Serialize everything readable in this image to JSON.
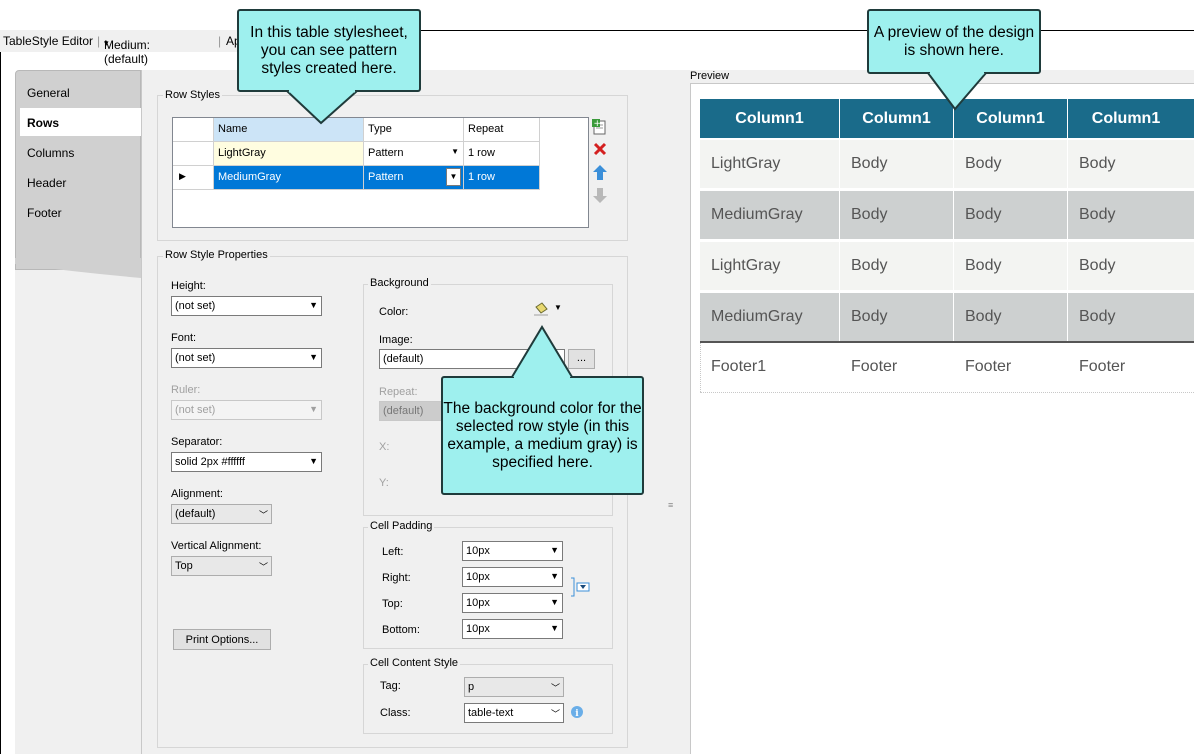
{
  "toolbar": {
    "title": "TableStyle Editor",
    "style_dropdown": "Medium: (default)",
    "truncated_button": "Ap"
  },
  "tabs": [
    {
      "label": "General",
      "active": false
    },
    {
      "label": "Rows",
      "active": true
    },
    {
      "label": "Columns",
      "active": false
    },
    {
      "label": "Header",
      "active": false
    },
    {
      "label": "Footer",
      "active": false
    }
  ],
  "row_styles": {
    "group_title": "Row Styles",
    "columns": [
      "Name",
      "Type",
      "Repeat"
    ],
    "rows": [
      {
        "name": "LightGray",
        "type": "Pattern",
        "repeat": "1 row",
        "selected": false
      },
      {
        "name": "MediumGray",
        "type": "Pattern",
        "repeat": "1 row",
        "selected": true
      }
    ]
  },
  "props": {
    "group_title": "Row Style Properties",
    "height_label": "Height:",
    "height_value": "(not set)",
    "font_label": "Font:",
    "font_value": "(not set)",
    "ruler_label": "Ruler:",
    "ruler_value": "(not set)",
    "separator_label": "Separator:",
    "separator_value": "solid 2px #ffffff",
    "alignment_label": "Alignment:",
    "alignment_value": "(default)",
    "valign_label": "Vertical Alignment:",
    "valign_value": "Top",
    "print_options": "Print Options..."
  },
  "background": {
    "group_title": "Background",
    "color_label": "Color:",
    "image_label": "Image:",
    "image_value": "(default)",
    "browse": "...",
    "repeat_label": "Repeat:",
    "repeat_value": "(default)",
    "x_label": "X:",
    "y_label": "Y:"
  },
  "cell_padding": {
    "group_title": "Cell Padding",
    "left_label": "Left:",
    "left_value": "10px",
    "right_label": "Right:",
    "right_value": "10px",
    "top_label": "Top:",
    "top_value": "10px",
    "bottom_label": "Bottom:",
    "bottom_value": "10px"
  },
  "cell_content": {
    "group_title": "Cell Content Style",
    "tag_label": "Tag:",
    "tag_value": "p",
    "class_label": "Class:",
    "class_value": "table-text"
  },
  "preview": {
    "title": "Preview",
    "headers": [
      "Column1",
      "Column1",
      "Column1",
      "Column1"
    ],
    "rows": [
      {
        "style": "light",
        "cells": [
          "LightGray",
          "Body",
          "Body",
          "Body"
        ]
      },
      {
        "style": "medium",
        "cells": [
          "MediumGray",
          "Body",
          "Body",
          "Body"
        ]
      },
      {
        "style": "light",
        "cells": [
          "LightGray",
          "Body",
          "Body",
          "Body"
        ]
      },
      {
        "style": "medium",
        "cells": [
          "MediumGray",
          "Body",
          "Body",
          "Body"
        ]
      }
    ],
    "footer": [
      "Footer1",
      "Footer",
      "Footer",
      "Footer"
    ]
  },
  "callouts": {
    "stylesheet": "In this table stylesheet, you can see pattern styles created here.",
    "preview": "A preview of the design is shown here.",
    "background": "The background color for the selected row style (in this example, a medium gray) is specified here."
  },
  "colors": {
    "header_bg": "#1a6b8a",
    "light_row": "#f3f4f2",
    "medium_row": "#cdd0d0",
    "selected_row": "#0078d7",
    "callout_bg": "#9ef0ee"
  }
}
